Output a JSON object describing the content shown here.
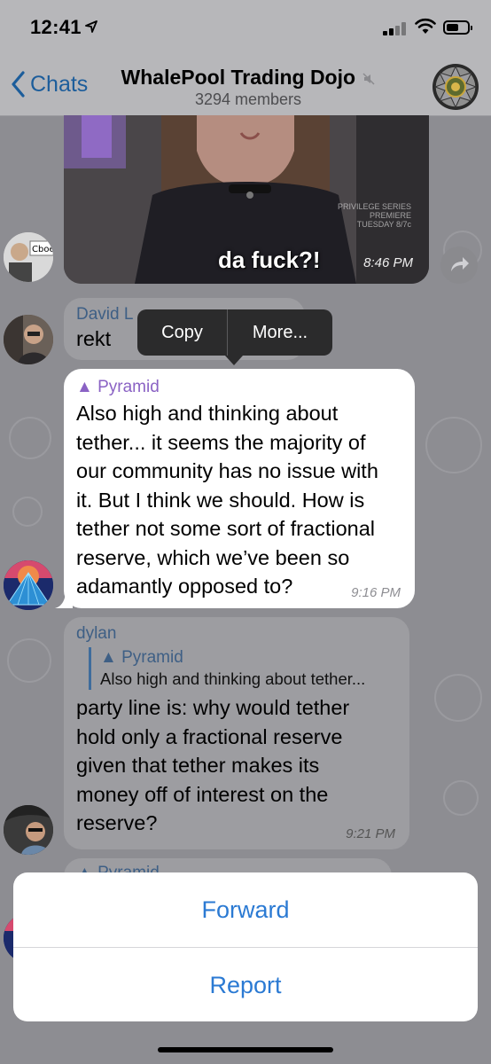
{
  "status_bar": {
    "time": "12:41"
  },
  "nav": {
    "back_label": "Chats",
    "title": "WhalePool Trading Dojo",
    "subtitle": "3294 members"
  },
  "messages": {
    "photo": {
      "caption": "da fuck?!",
      "watermark": "PRIVILEGE SERIES PREMIERE TUESDAY 8/7c",
      "time": "8:46 PM",
      "avatar_label": "Cboe"
    },
    "david": {
      "sender": "David L",
      "text": "rekt"
    },
    "pyramid": {
      "sender": "▲ Pyramid",
      "text": "Also high and thinking about tether... it seems the majority of our community has no issue with it. But I think we should. How is tether not some sort of fractional reserve, which we’ve been so adamantly opposed to?",
      "lines": [
        "Also high and thinking about",
        "tether... it seems the majority of",
        "our community has no issue with",
        "it. But I think we should. How is",
        "tether not some sort of fractional",
        "reserve, which we’ve been so",
        "adamantly opposed to?"
      ],
      "time": "9:16 PM"
    },
    "dylan": {
      "sender": "dylan",
      "reply_name": "▲ Pyramid",
      "reply_text": "Also high and thinking about tether...",
      "lines": [
        "party line is: why would tether",
        "hold only a fractional reserve",
        "given that tether makes its",
        "money off of interest on the",
        "reserve?"
      ],
      "time": "9:21 PM"
    },
    "next_partial": {
      "sender": "▲ Pyramid"
    }
  },
  "context_menu": {
    "copy": "Copy",
    "more": "More..."
  },
  "action_sheet": {
    "forward": "Forward",
    "report": "Report"
  },
  "colors": {
    "accent": "#2b7ad3",
    "nav_link": "#1c5d9b",
    "sender_purple": "#8a62c4",
    "sender_blue": "#3e5f85"
  }
}
